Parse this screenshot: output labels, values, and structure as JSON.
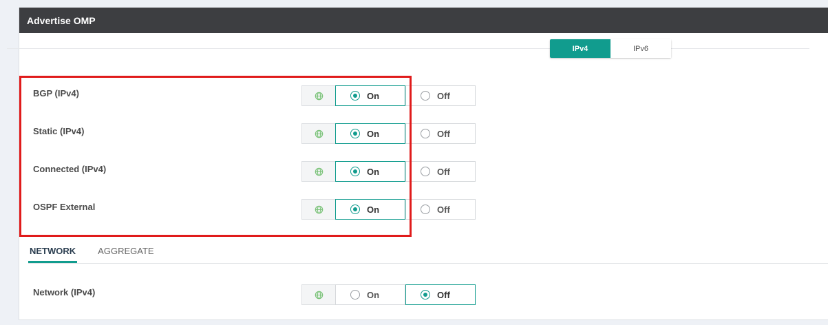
{
  "panel": {
    "title": "Advertise OMP"
  },
  "ip_version": {
    "options": [
      "IPv4",
      "IPv6"
    ],
    "selected": "IPv4"
  },
  "colors": {
    "accent": "#119c8e",
    "highlight": "#e01b1b",
    "header": "#3d3e41"
  },
  "rows": [
    {
      "label": "BGP (IPv4)",
      "on": "On",
      "off": "Off",
      "value": "On"
    },
    {
      "label": "Static (IPv4)",
      "on": "On",
      "off": "Off",
      "value": "On"
    },
    {
      "label": "Connected (IPv4)",
      "on": "On",
      "off": "Off",
      "value": "On"
    },
    {
      "label": "OSPF External",
      "on": "On",
      "off": "Off",
      "value": "On"
    }
  ],
  "tabs": {
    "items": [
      "NETWORK",
      "AGGREGATE"
    ],
    "active": "NETWORK"
  },
  "network_row": {
    "label": "Network (IPv4)",
    "on": "On",
    "off": "Off",
    "value": "Off"
  },
  "icons": {
    "scope": "globe-icon"
  }
}
